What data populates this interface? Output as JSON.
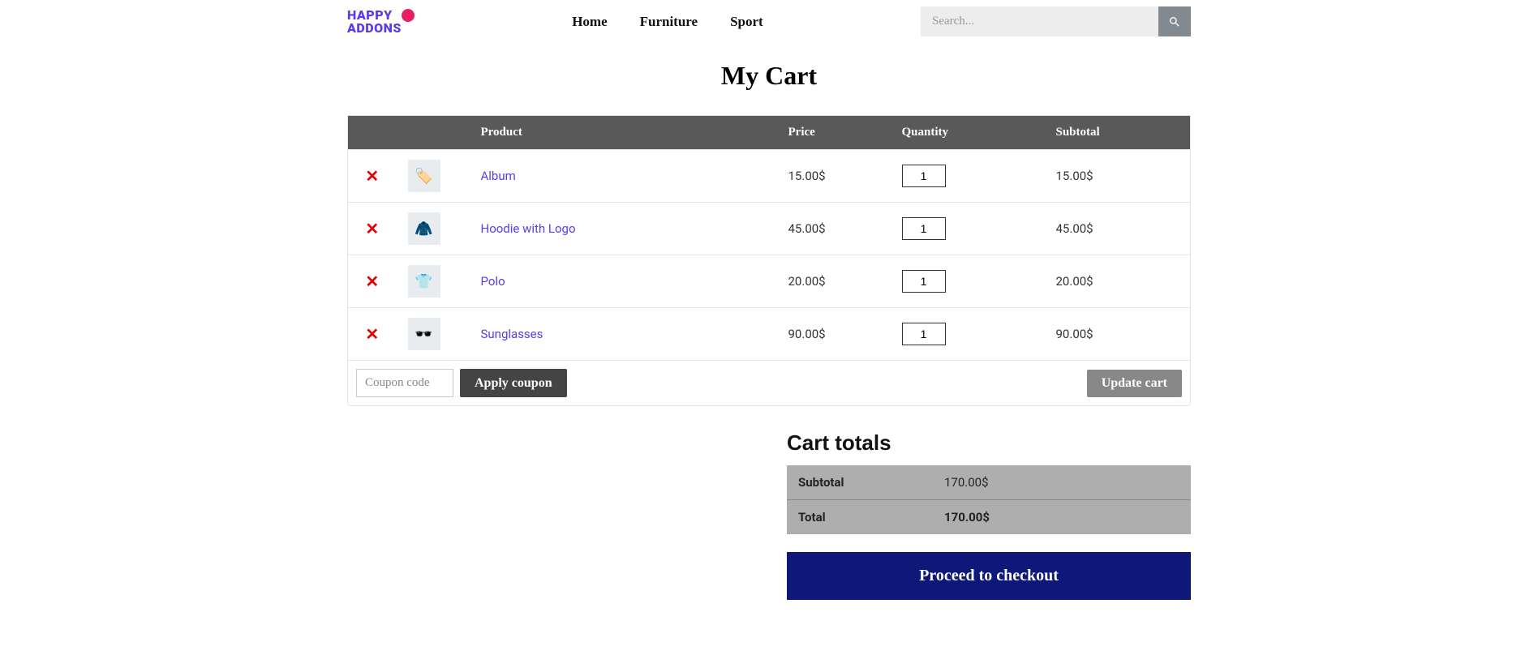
{
  "logo": {
    "line1": "HAPPY",
    "line2": "ADDONS"
  },
  "nav": {
    "home": "Home",
    "furniture": "Furniture",
    "sport": "Sport"
  },
  "search": {
    "placeholder": "Search..."
  },
  "page_title": "My Cart",
  "table": {
    "headers": {
      "product": "Product",
      "price": "Price",
      "quantity": "Quantity",
      "subtotal": "Subtotal"
    },
    "rows": [
      {
        "name": "Album",
        "price": "15.00$",
        "qty": "1",
        "subtotal": "15.00$"
      },
      {
        "name": "Hoodie with Logo",
        "price": "45.00$",
        "qty": "1",
        "subtotal": "45.00$"
      },
      {
        "name": "Polo",
        "price": "20.00$",
        "qty": "1",
        "subtotal": "20.00$"
      },
      {
        "name": "Sunglasses",
        "price": "90.00$",
        "qty": "1",
        "subtotal": "90.00$"
      }
    ]
  },
  "coupon": {
    "placeholder": "Coupon code",
    "apply": "Apply coupon"
  },
  "update_cart": "Update cart",
  "totals": {
    "title": "Cart totals",
    "subtotal_label": "Subtotal",
    "subtotal_value": "170.00$",
    "total_label": "Total",
    "total_value": "170.00$"
  },
  "checkout": "Proceed to checkout"
}
